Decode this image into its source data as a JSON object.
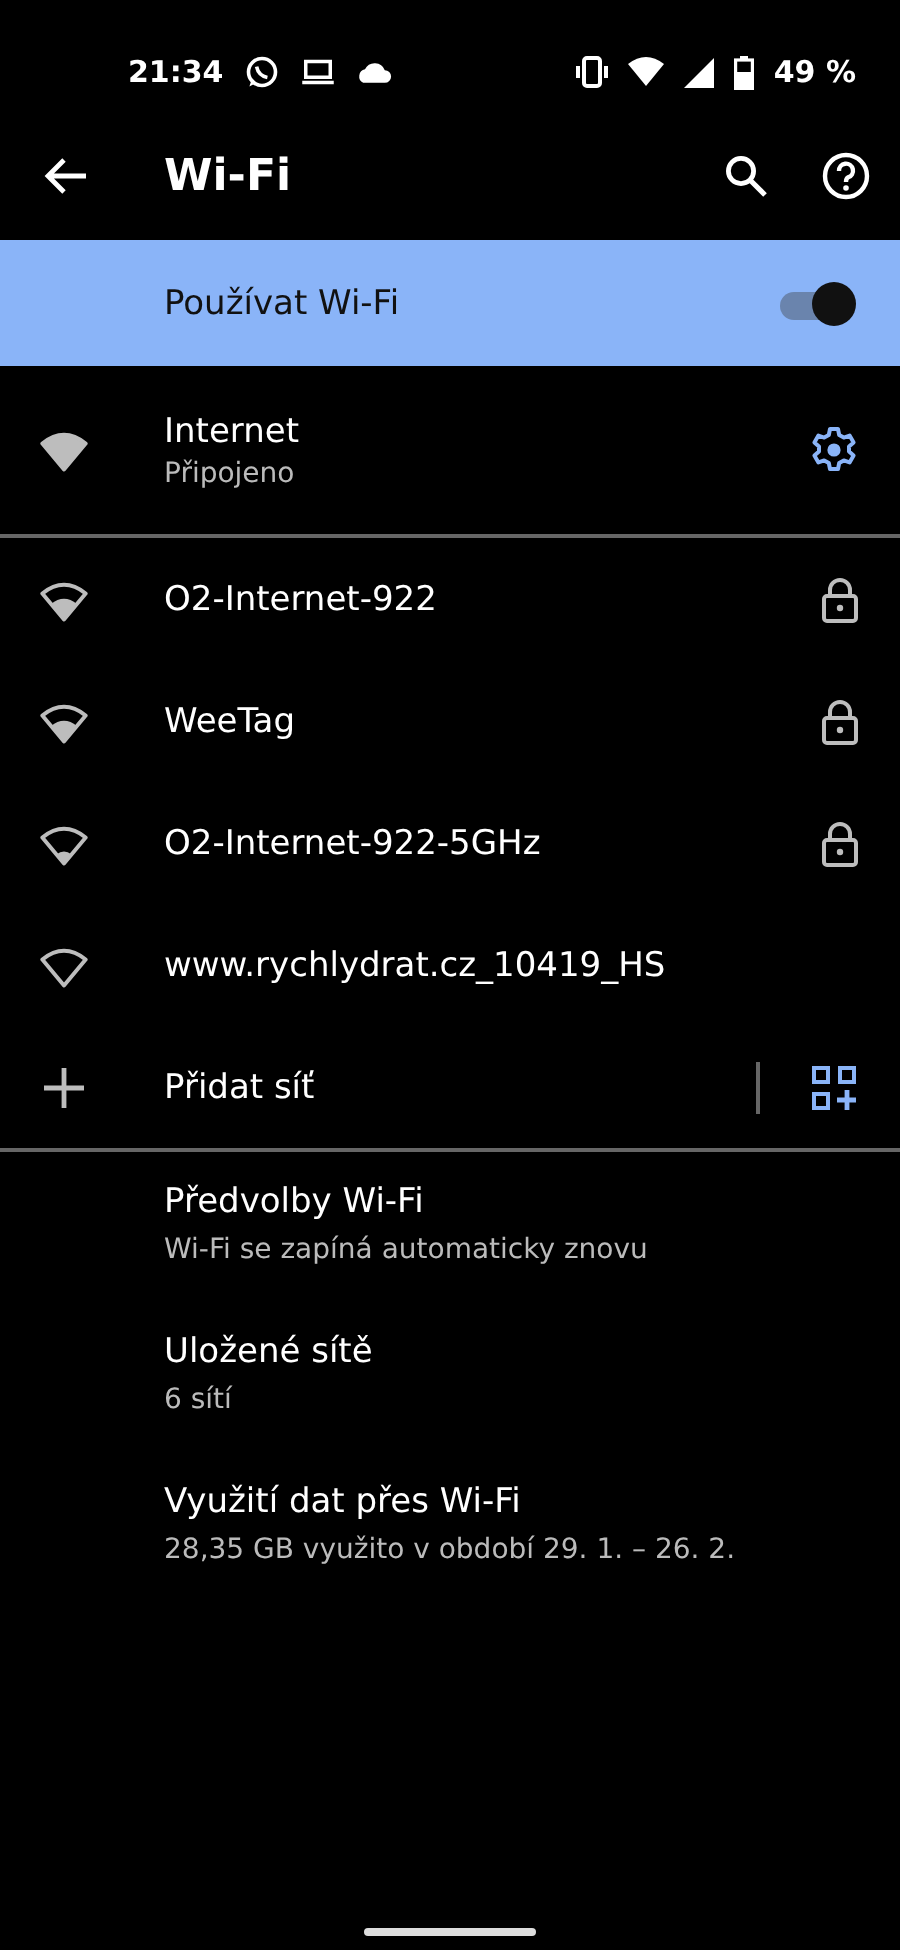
{
  "status_bar": {
    "time": "21:34",
    "battery": "49 %"
  },
  "app_bar": {
    "title": "Wi-Fi"
  },
  "master_switch": {
    "label": "Používat Wi-Fi",
    "checked": true
  },
  "connected": {
    "name": "Internet",
    "status": "Připojeno",
    "kind": "strong"
  },
  "networks": [
    {
      "name": "O2-Internet-922",
      "kind": "medium",
      "locked": true
    },
    {
      "name": "WeeTag",
      "kind": "medium",
      "locked": true
    },
    {
      "name": "O2-Internet-922-5GHz",
      "kind": "weak",
      "locked": true
    },
    {
      "name": "www.rychlydrat.cz_10419_HS",
      "kind": "open",
      "locked": false
    }
  ],
  "add_network": {
    "label": "Přidat síť"
  },
  "settings": [
    {
      "title": "Předvolby Wi-Fi",
      "summary": "Wi-Fi se zapíná automaticky znovu"
    },
    {
      "title": "Uložené sítě",
      "summary": "6 sítí"
    },
    {
      "title": "Využití dat přes Wi-Fi",
      "summary": "28,35 GB využito v období 29. 1. – 26. 2."
    }
  ]
}
